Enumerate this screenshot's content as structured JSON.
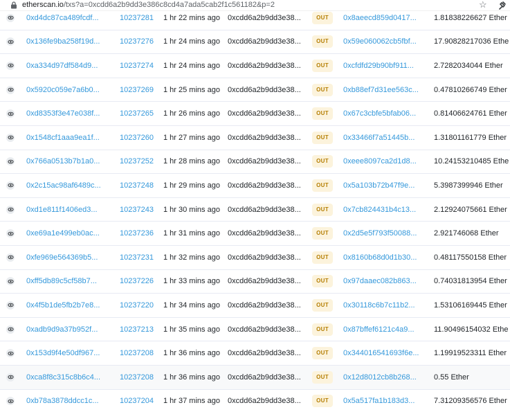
{
  "browser": {
    "url_host": "etherscan.io",
    "url_path": "/txs?a=0xcdd6a2b9dd3e386c8cd4a7ada5cab2f1c561182&p=2"
  },
  "transactions": [
    {
      "hash": "0xd4dc87ca489fcdf...",
      "block": "10237281",
      "age": "1 hr 22 mins ago",
      "from": "0xcdd6a2b9dd3e38...",
      "direction": "OUT",
      "to": "0x8aeecd859d0417...",
      "value": "1.81838226627 Ether"
    },
    {
      "hash": "0x136fe9ba258f19d...",
      "block": "10237276",
      "age": "1 hr 24 mins ago",
      "from": "0xcdd6a2b9dd3e38...",
      "direction": "OUT",
      "to": "0x59e060062cb5fbf...",
      "value": "17.90828217036 Ethe"
    },
    {
      "hash": "0xa334d97df584d9...",
      "block": "10237274",
      "age": "1 hr 24 mins ago",
      "from": "0xcdd6a2b9dd3e38...",
      "direction": "OUT",
      "to": "0xcfdfd29b90bf911...",
      "value": "2.7282034044 Ether"
    },
    {
      "hash": "0x5920c059e7a6b0...",
      "block": "10237269",
      "age": "1 hr 25 mins ago",
      "from": "0xcdd6a2b9dd3e38...",
      "direction": "OUT",
      "to": "0xb88ef7d31ee563c...",
      "value": "0.47810266749 Ether"
    },
    {
      "hash": "0xd8353f3e47e038f...",
      "block": "10237265",
      "age": "1 hr 26 mins ago",
      "from": "0xcdd6a2b9dd3e38...",
      "direction": "OUT",
      "to": "0x67c3cbfe5bfab06...",
      "value": "0.81406624761 Ether"
    },
    {
      "hash": "0x1548cf1aaa9ea1f...",
      "block": "10237260",
      "age": "1 hr 27 mins ago",
      "from": "0xcdd6a2b9dd3e38...",
      "direction": "OUT",
      "to": "0x33466f7a51445b...",
      "value": "1.31801161779 Ether"
    },
    {
      "hash": "0x766a0513b7b1a0...",
      "block": "10237252",
      "age": "1 hr 28 mins ago",
      "from": "0xcdd6a2b9dd3e38...",
      "direction": "OUT",
      "to": "0xeee8097ca2d1d8...",
      "value": "10.24153210485 Ethe"
    },
    {
      "hash": "0x2c15ac98af6489c...",
      "block": "10237248",
      "age": "1 hr 29 mins ago",
      "from": "0xcdd6a2b9dd3e38...",
      "direction": "OUT",
      "to": "0x5a103b72b47f9e...",
      "value": "5.3987399946 Ether"
    },
    {
      "hash": "0xd1e811f1406ed3...",
      "block": "10237243",
      "age": "1 hr 30 mins ago",
      "from": "0xcdd6a2b9dd3e38...",
      "direction": "OUT",
      "to": "0x7cb824431b4c13...",
      "value": "2.12924075661 Ether"
    },
    {
      "hash": "0xe69a1e499eb0ac...",
      "block": "10237236",
      "age": "1 hr 31 mins ago",
      "from": "0xcdd6a2b9dd3e38...",
      "direction": "OUT",
      "to": "0x2d5e5f793f50088...",
      "value": "2.921746068 Ether"
    },
    {
      "hash": "0xfe969e564369b5...",
      "block": "10237231",
      "age": "1 hr 32 mins ago",
      "from": "0xcdd6a2b9dd3e38...",
      "direction": "OUT",
      "to": "0x8160b68d0d1b30...",
      "value": "0.48117550158 Ether"
    },
    {
      "hash": "0xff5db89c5cf58b7...",
      "block": "10237226",
      "age": "1 hr 33 mins ago",
      "from": "0xcdd6a2b9dd3e38...",
      "direction": "OUT",
      "to": "0x97daaec082b863...",
      "value": "0.74031813954 Ether"
    },
    {
      "hash": "0x4f5b1de5fb2b7e8...",
      "block": "10237220",
      "age": "1 hr 34 mins ago",
      "from": "0xcdd6a2b9dd3e38...",
      "direction": "OUT",
      "to": "0x30118c6b7c11b2...",
      "value": "1.53106169445 Ether"
    },
    {
      "hash": "0xadb9d9a37b952f...",
      "block": "10237213",
      "age": "1 hr 35 mins ago",
      "from": "0xcdd6a2b9dd3e38...",
      "direction": "OUT",
      "to": "0x87bffef6121c4a9...",
      "value": "11.90496154032 Ethe"
    },
    {
      "hash": "0x153d9f4e50df967...",
      "block": "10237208",
      "age": "1 hr 36 mins ago",
      "from": "0xcdd6a2b9dd3e38...",
      "direction": "OUT",
      "to": "0x344016541693f6e...",
      "value": "1.19919523311 Ether"
    },
    {
      "hash": "0xca8f8c315c8b6c4...",
      "block": "10237208",
      "age": "1 hr 36 mins ago",
      "from": "0xcdd6a2b9dd3e38...",
      "direction": "OUT",
      "to": "0x12d8012cb8b268...",
      "value": "0.55 Ether"
    },
    {
      "hash": "0xb78a3878ddcc1c...",
      "block": "10237204",
      "age": "1 hr 37 mins ago",
      "from": "0xcdd6a2b9dd3e38...",
      "direction": "OUT",
      "to": "0x5a517fa1b183d3...",
      "value": "7.31209356576 Ether"
    }
  ]
}
